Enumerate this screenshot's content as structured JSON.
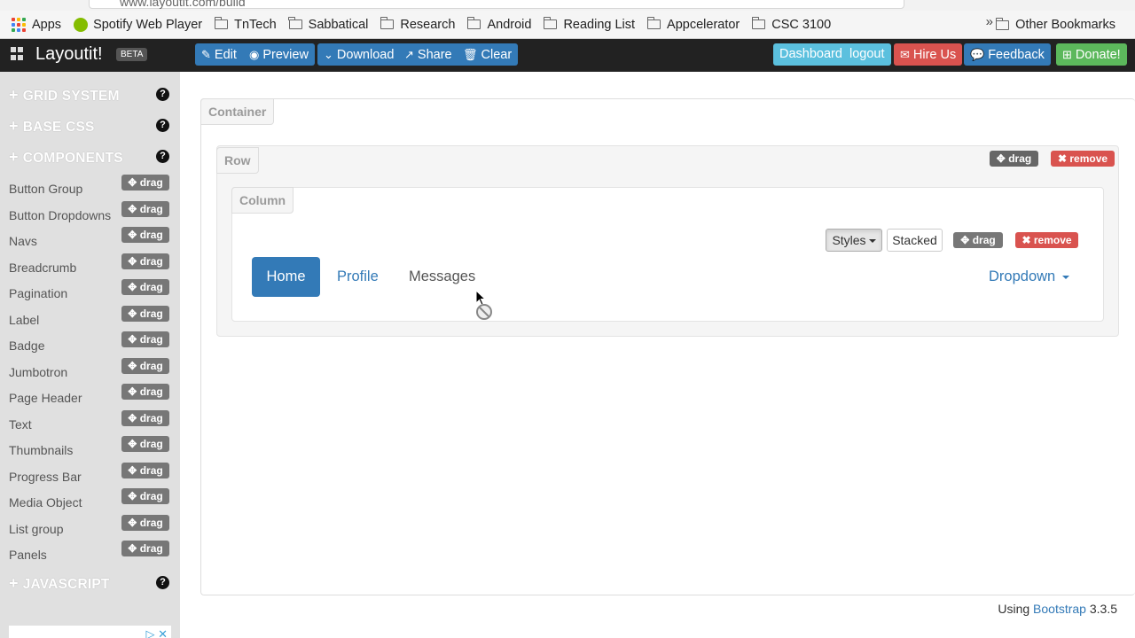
{
  "browser": {
    "url": "www.layoutit.com/build",
    "bookmarks": [
      {
        "label": "Apps",
        "icon": "apps-grid-icon"
      },
      {
        "label": "Spotify Web Player",
        "icon": "spotify-icon"
      },
      {
        "label": "TnTech",
        "icon": "folder-icon"
      },
      {
        "label": "Sabbatical",
        "icon": "folder-icon"
      },
      {
        "label": "Research",
        "icon": "folder-icon"
      },
      {
        "label": "Android",
        "icon": "folder-icon"
      },
      {
        "label": "Reading List",
        "icon": "folder-icon"
      },
      {
        "label": "Appcelerator",
        "icon": "folder-icon"
      },
      {
        "label": "CSC 3100",
        "icon": "folder-icon"
      }
    ],
    "more": "»",
    "other_bookmarks": "Other Bookmarks"
  },
  "navbar": {
    "brand": "Layoutit!",
    "beta": "BETA",
    "edit": "Edit",
    "preview": "Preview",
    "download": "Download",
    "share": "Share",
    "clear": "Clear",
    "dashboard": "Dashboard",
    "logout": "logout",
    "hire_us": "Hire Us",
    "feedback": "Feedback",
    "donate": "Donate!"
  },
  "sidebar": {
    "sections": {
      "grid": "GRID SYSTEM",
      "base_css": "BASE CSS",
      "components": "COMPONENTS",
      "javascript": "JAVASCRIPT"
    },
    "help": "?",
    "drag_label": "drag",
    "components": [
      "Button Group",
      "Button Dropdowns",
      "Navs",
      "Breadcrumb",
      "Pagination",
      "Label",
      "Badge",
      "Jumbotron",
      "Page Header",
      "Text",
      "Thumbnails",
      "Progress Bar",
      "Media Object",
      "List group",
      "Panels"
    ]
  },
  "canvas": {
    "container_label": "Container",
    "row_label": "Row",
    "column_label": "Column",
    "drag": "drag",
    "remove": "remove",
    "styles": "Styles",
    "stacked": "Stacked",
    "nav": {
      "home": "Home",
      "profile": "Profile",
      "messages": "Messages",
      "dropdown": "Dropdown"
    }
  },
  "footer": {
    "prefix": "Using ",
    "link": "Bootstrap",
    "version": " 3.3.5"
  },
  "colors": {
    "primary": "#337ab7",
    "info": "#5bc0de",
    "danger": "#d9534f",
    "success": "#5cb85c",
    "navbar": "#222222",
    "sidebar": "#e0e0e0"
  }
}
